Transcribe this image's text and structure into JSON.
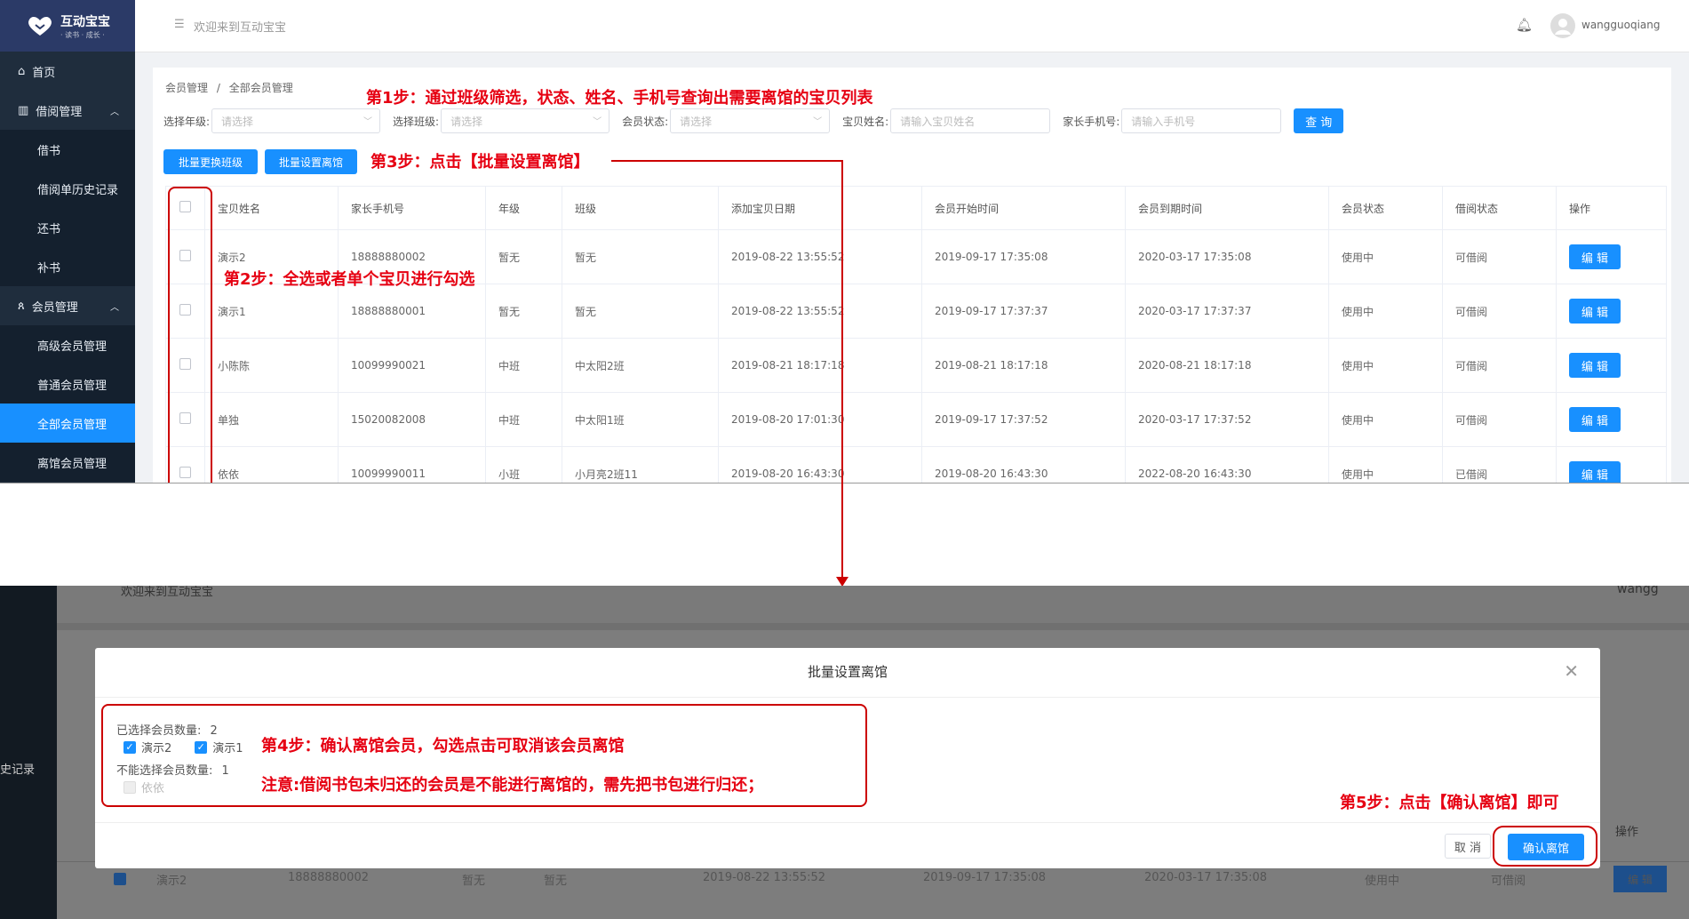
{
  "sidebar": {
    "logo_text": "互动宝宝",
    "logo_sub": "· 读书 · 成长 ·",
    "items": [
      {
        "label": "首页"
      },
      {
        "label": "借阅管理"
      },
      {
        "label": "借书"
      },
      {
        "label": "借阅单历史记录"
      },
      {
        "label": "还书"
      },
      {
        "label": "补书"
      },
      {
        "label": "会员管理"
      },
      {
        "label": "高级会员管理"
      },
      {
        "label": "普通会员管理"
      },
      {
        "label": "全部会员管理"
      },
      {
        "label": "离馆会员管理"
      }
    ]
  },
  "topbar": {
    "welcome": "欢迎来到互动宝宝",
    "username": "wangguoqiang"
  },
  "breadcrumb": {
    "parent": "会员管理",
    "sep": "/",
    "current": "全部会员管理"
  },
  "filters": {
    "grade_label": "选择年级:",
    "grade_placeholder": "请选择",
    "class_label": "选择班级:",
    "class_placeholder": "请选择",
    "status_label": "会员状态:",
    "status_placeholder": "请选择",
    "name_label": "宝贝姓名:",
    "name_placeholder": "请输入宝贝姓名",
    "phone_label": "家长手机号:",
    "phone_placeholder": "请输入手机号",
    "search_button": "查 询"
  },
  "actions": {
    "batch_change_class": "批量更换班级",
    "batch_leave": "批量设置离馆"
  },
  "table": {
    "headers": [
      "宝贝姓名",
      "家长手机号",
      "年级",
      "班级",
      "添加宝贝日期",
      "会员开始时间",
      "会员到期时间",
      "会员状态",
      "借阅状态",
      "操作"
    ],
    "edit_label": "编 辑",
    "rows": [
      [
        "演示2",
        "18888880002",
        "暂无",
        "暂无",
        "2019-08-22 13:55:52",
        "2019-09-17 17:35:08",
        "2020-03-17 17:35:08",
        "使用中",
        "可借阅"
      ],
      [
        "演示1",
        "18888880001",
        "暂无",
        "暂无",
        "2019-08-22 13:55:52",
        "2019-09-17 17:37:37",
        "2020-03-17 17:37:37",
        "使用中",
        "可借阅"
      ],
      [
        "小陈陈",
        "10099990021",
        "中班",
        "中太阳2班",
        "2019-08-21 18:17:18",
        "2019-08-21 18:17:18",
        "2020-08-21 18:17:18",
        "使用中",
        "可借阅"
      ],
      [
        "单独",
        "15020082008",
        "中班",
        "中太阳1班",
        "2019-08-20 17:01:30",
        "2019-09-17 17:37:52",
        "2020-03-17 17:37:52",
        "使用中",
        "可借阅"
      ],
      [
        "依依",
        "10099990011",
        "小班",
        "小月亮2班11",
        "2019-08-20 16:43:30",
        "2019-08-20 16:43:30",
        "2022-08-20 16:43:30",
        "使用中",
        "已借阅"
      ]
    ]
  },
  "annotations": {
    "step1": "第1步：通过班级筛选，状态、姓名、手机号查询出需要离馆的宝贝列表",
    "step2": "第2步：全选或者单个宝贝进行勾选",
    "step3": "第3步：点击【批量设置离馆】",
    "step4": "第4步：确认离馆会员，勾选点击可取消该会员离馆",
    "note": "注意:借阅书包未归还的会员是不能进行离馆的，需先把书包进行归还；",
    "step5": "第5步：点击【确认离馆】即可"
  },
  "modal": {
    "title": "批量设置离馆",
    "selected_label": "已选择会员数量:",
    "selected_count": "2",
    "selected_members": [
      "演示2",
      "演示1"
    ],
    "unselectable_label": "不能选择会员数量:",
    "unselectable_count": "1",
    "unselectable_members": [
      "依依"
    ],
    "cancel": "取 消",
    "confirm": "确认离馆"
  },
  "background": {
    "welcome": "欢迎来到互动宝宝",
    "user_fragment": "wangg",
    "sidebar_fragment": "史记录",
    "op_header": "操作",
    "row": [
      "演示2",
      "18888880002",
      "暂无",
      "暂无",
      "2019-08-22 13:55:52",
      "2019-09-17 17:35:08",
      "2020-03-17 17:35:08",
      "使用中",
      "可借阅"
    ],
    "edit_label": "编 辑"
  },
  "colors": {
    "primary": "#1890ff",
    "sidebar": "#1f2d3d",
    "annotation": "#e60012"
  }
}
